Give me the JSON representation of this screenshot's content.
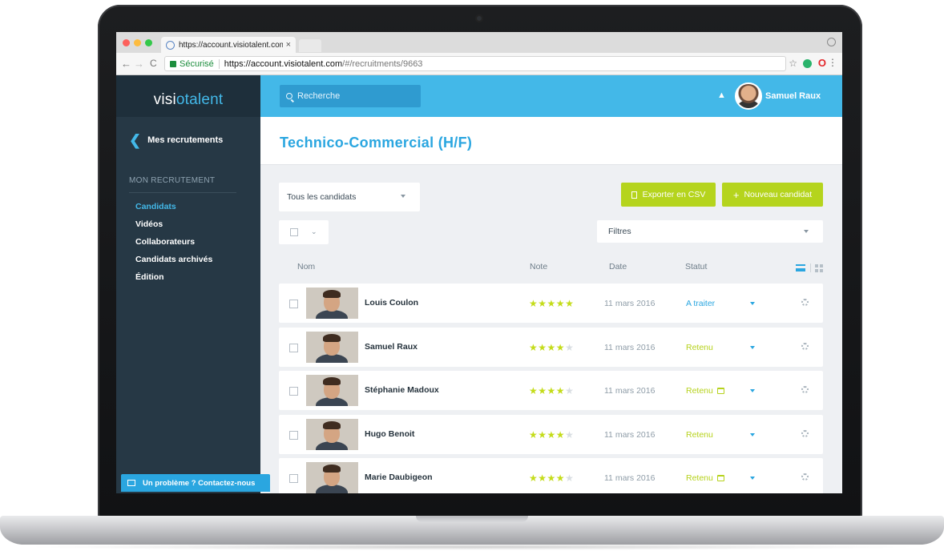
{
  "browser": {
    "tab_title": "https://account.visiotalent.com",
    "tab_close": "×",
    "secure_label": "Sécurisé",
    "url_host": "https://account.visiotalent.com",
    "url_path": "/#/recruitments/9663"
  },
  "icons": {
    "back": "←",
    "forward": "→",
    "reload": "C",
    "star": "☆",
    "menu": "⋮",
    "opera": "O",
    "bell": "🔔",
    "chevron_left": "❮",
    "plus": "+",
    "caret": "⌄"
  },
  "colors": {
    "accent": "#43b8e8",
    "sidebar": "#263845",
    "action_green": "#b5d41d",
    "status_blue": "#2aa6e0",
    "status_green": "#b6d21c"
  },
  "app": {
    "logo_left": "visi",
    "logo_accent": "o",
    "logo_right": "talent",
    "search_placeholder": "Recherche",
    "user_name": "Samuel Raux"
  },
  "sidebar": {
    "back_label": "Mes recrutements",
    "section_title": "MON RECRUTEMENT",
    "items": [
      {
        "label": "Candidats",
        "active": true
      },
      {
        "label": "Vidéos",
        "active": false
      },
      {
        "label": "Collaborateurs",
        "active": false
      },
      {
        "label": "Candidats archivés",
        "active": false
      },
      {
        "label": "Édition",
        "active": false
      }
    ],
    "help_label": "Un problème ? Contactez-nous"
  },
  "main": {
    "page_title": "Technico-Commercial (H/F)",
    "candidate_filter": "Tous les candidats",
    "export_button": "Exporter en CSV",
    "new_candidate_button": "Nouveau candidat",
    "filters_label": "Filtres",
    "columns": {
      "name": "Nom",
      "rating": "Note",
      "date": "Date",
      "status": "Statut"
    }
  },
  "candidates": [
    {
      "name": "Louis Coulon",
      "rating": 5,
      "date": "11 mars 2016",
      "status": "A traiter",
      "status_kind": "blue",
      "calendar": false
    },
    {
      "name": "Samuel Raux",
      "rating": 4,
      "date": "11 mars 2016",
      "status": "Retenu",
      "status_kind": "green",
      "calendar": false
    },
    {
      "name": "Stéphanie Madoux",
      "rating": 4,
      "date": "11 mars 2016",
      "status": "Retenu",
      "status_kind": "green",
      "calendar": true
    },
    {
      "name": "Hugo Benoit",
      "rating": 4,
      "date": "11 mars 2016",
      "status": "Retenu",
      "status_kind": "green",
      "calendar": false
    },
    {
      "name": "Marie Daubigeon",
      "rating": 4,
      "date": "11 mars 2016",
      "status": "Retenu",
      "status_kind": "green",
      "calendar": true
    }
  ]
}
